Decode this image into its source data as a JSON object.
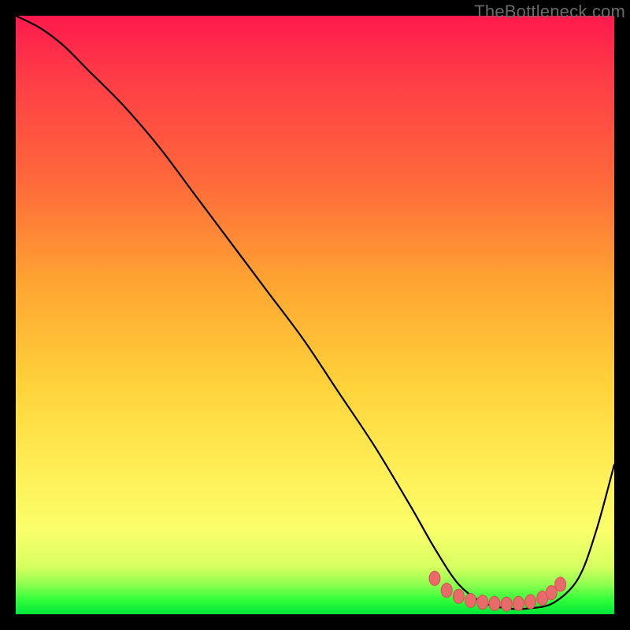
{
  "watermark": "TheBottleneck.com",
  "colors": {
    "curve_stroke": "#000000",
    "marker_fill": "#e86a6a",
    "marker_stroke": "#d94f4f"
  },
  "chart_data": {
    "type": "line",
    "title": "",
    "xlabel": "",
    "ylabel": "",
    "xlim": [
      0,
      100
    ],
    "ylim": [
      0,
      100
    ],
    "series": [
      {
        "name": "bottleneck-curve",
        "x": [
          0,
          4,
          8,
          12,
          18,
          24,
          30,
          36,
          42,
          48,
          54,
          60,
          66,
          70,
          74,
          78,
          82,
          86,
          90,
          94,
          97,
          100
        ],
        "y": [
          100,
          98,
          95,
          91,
          85,
          78,
          70,
          62,
          54,
          46,
          37,
          28,
          18,
          11,
          5,
          2,
          1,
          1,
          2,
          6,
          14,
          25
        ]
      }
    ],
    "markers": {
      "name": "bottom-cluster",
      "points": [
        {
          "x": 70,
          "y": 6
        },
        {
          "x": 72,
          "y": 4
        },
        {
          "x": 74,
          "y": 3
        },
        {
          "x": 76,
          "y": 2.3
        },
        {
          "x": 78,
          "y": 2
        },
        {
          "x": 80,
          "y": 1.8
        },
        {
          "x": 82,
          "y": 1.7
        },
        {
          "x": 84,
          "y": 1.8
        },
        {
          "x": 86,
          "y": 2.1
        },
        {
          "x": 88,
          "y": 2.7
        },
        {
          "x": 89.5,
          "y": 3.6
        },
        {
          "x": 91,
          "y": 5
        }
      ]
    }
  }
}
